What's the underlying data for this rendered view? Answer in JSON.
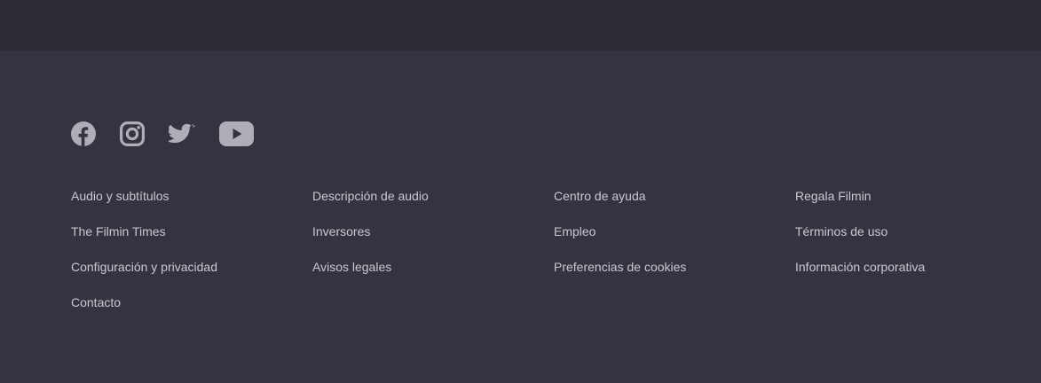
{
  "social": [
    {
      "name": "Facebook",
      "icon": "facebook-icon"
    },
    {
      "name": "Instagram",
      "icon": "instagram-icon"
    },
    {
      "name": "Twitter",
      "icon": "twitter-icon"
    },
    {
      "name": "YouTube",
      "icon": "youtube-icon"
    }
  ],
  "footer": {
    "links": [
      "Audio y subtítulos",
      "Descripción de audio",
      "Centro de ayuda",
      "Regala Filmin",
      "The Filmin Times",
      "Inversores",
      "Empleo",
      "Términos de uso",
      "Configuración y privacidad",
      "Avisos legales",
      "Preferencias de cookies",
      "Información corporativa",
      "Contacto"
    ]
  },
  "colors": {
    "background": "#34333f",
    "top_band": "#2d2c37",
    "icon": "#aeadb8",
    "link_text": "#c9c8d2"
  }
}
